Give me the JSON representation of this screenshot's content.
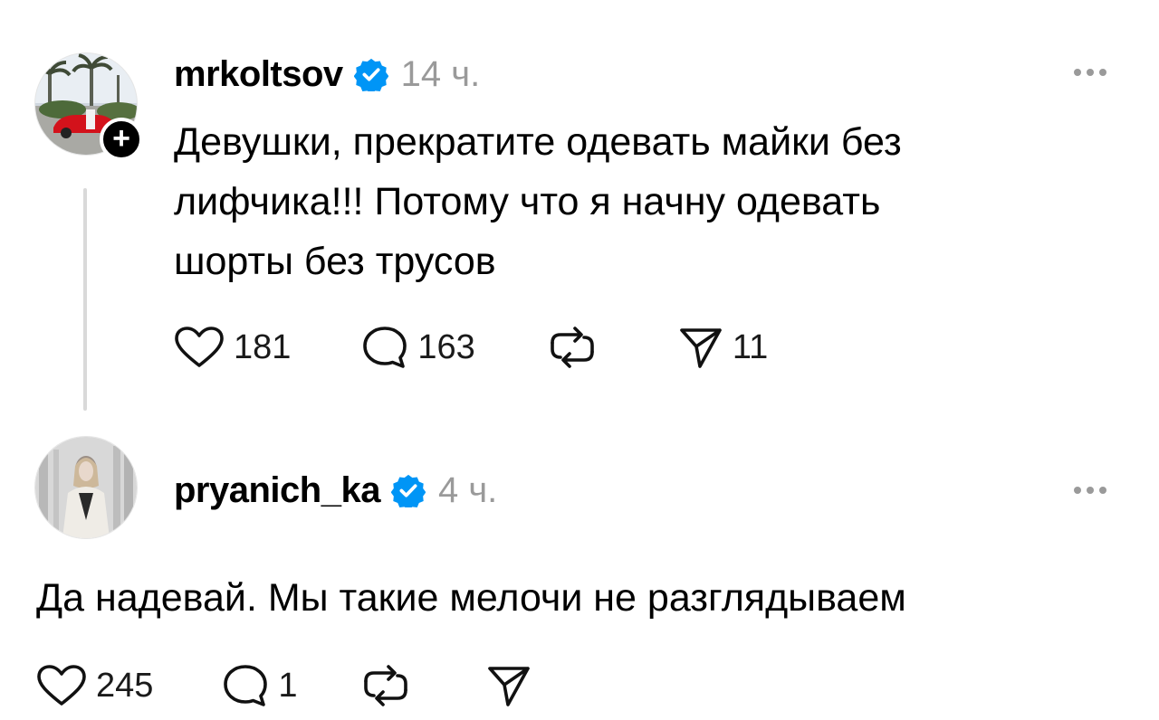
{
  "post": {
    "username": "mrkoltsov",
    "time": "14 ч.",
    "text_lines": [
      "Девушки, прекратите одевать майки без",
      "лифчика!!! Потому что я начну одевать",
      "шорты без трусов"
    ],
    "likes": "181",
    "comments": "163",
    "shares": "11"
  },
  "reply": {
    "username": "pryanich_ka",
    "time": "4 ч.",
    "text": "Да надевай. Мы такие мелочи не разглядываем",
    "likes": "245",
    "comments": "1"
  },
  "icons": {
    "verified": "verified-badge-icon",
    "like": "heart-icon",
    "comment": "comment-bubble-icon",
    "repost": "repost-icon",
    "share": "send-icon",
    "more": "more-dots-icon",
    "follow": "plus-icon"
  },
  "colors": {
    "verified_blue": "#0095f6",
    "muted": "#9a9a9a",
    "thread_line": "#d9d9d9"
  }
}
